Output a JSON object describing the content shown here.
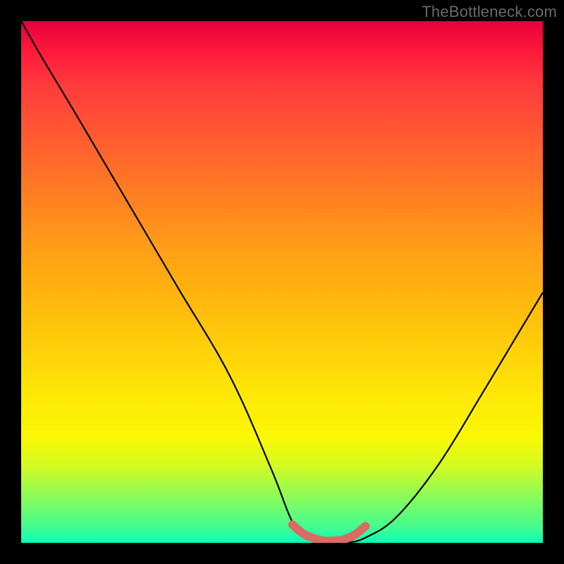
{
  "watermark_text": "TheBottleneck.com",
  "chart_data": {
    "type": "line",
    "title": "",
    "xlabel": "",
    "ylabel": "",
    "xlim": [
      0,
      100
    ],
    "ylim": [
      0,
      100
    ],
    "grid": false,
    "series": [
      {
        "name": "bottleneck-curve",
        "color": "#000000",
        "x": [
          0,
          4,
          10,
          20,
          30,
          40,
          48,
          52,
          55,
          58,
          62,
          66,
          72,
          80,
          88,
          94,
          100
        ],
        "y": [
          100,
          93,
          83,
          66,
          49,
          32,
          14,
          4,
          1,
          0,
          0,
          1,
          5,
          15,
          28,
          38,
          48
        ]
      },
      {
        "name": "optimal-zone-marker",
        "color": "#d86b63",
        "x": [
          52,
          54,
          56,
          58,
          60,
          62,
          64,
          66
        ],
        "y": [
          3.5,
          1.8,
          0.9,
          0.4,
          0.4,
          0.7,
          1.6,
          3.2
        ]
      }
    ],
    "annotations": []
  }
}
